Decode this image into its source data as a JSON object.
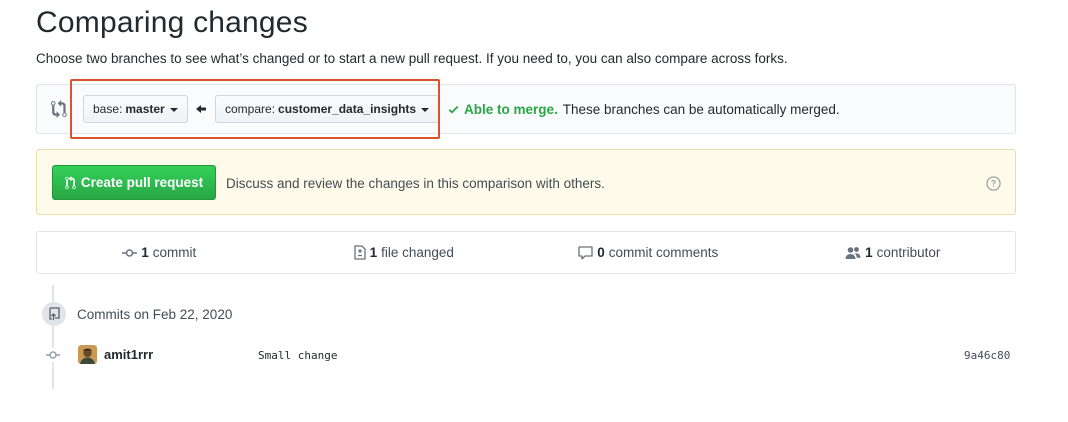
{
  "page": {
    "title": "Comparing changes",
    "subtitle": "Choose two branches to see what’s changed or to start a new pull request. If you need to, you can also compare across forks."
  },
  "range": {
    "base_label": "base:",
    "base_value": "master",
    "compare_label": "compare:",
    "compare_value": "customer_data_insights",
    "merge_ok": "Able to merge.",
    "merge_text": "These branches can be automatically merged."
  },
  "pull_request": {
    "button_label": "Create pull request",
    "description": "Discuss and review the changes in this comparison with others."
  },
  "stats": [
    {
      "count": "1",
      "label": "commit",
      "icon": "commit-icon"
    },
    {
      "count": "1",
      "label": "file changed",
      "icon": "file-diff-icon"
    },
    {
      "count": "0",
      "label": "commit comments",
      "icon": "comment-icon"
    },
    {
      "count": "1",
      "label": "contributor",
      "icon": "people-icon"
    }
  ],
  "commits": {
    "group_title": "Commits on Feb 22, 2020",
    "items": [
      {
        "author": "amit1rrr",
        "message": "Small change",
        "sha": "9a46c80"
      }
    ]
  },
  "colors": {
    "success": "#28a745",
    "highlight": "#d9532b",
    "flash_bg": "#fffbea"
  }
}
